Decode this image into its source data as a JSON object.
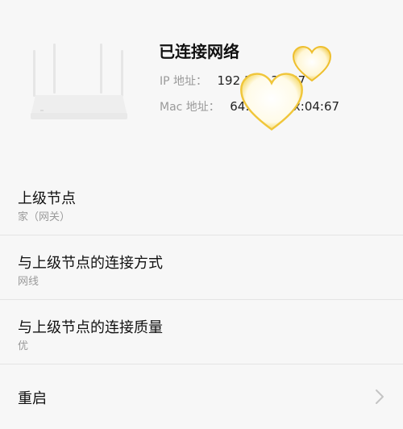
{
  "device": {
    "image": "router-image",
    "status": "已连接网络",
    "ip_label": "IP 地址：",
    "ip_value": "192.168.31.67",
    "mac_label": "Mac 地址：",
    "mac_value": "64:xx:xx:xx:04:67"
  },
  "items": [
    {
      "title": "上级节点",
      "subtitle": "家（网关）"
    },
    {
      "title": "与上级节点的连接方式",
      "subtitle": "网线"
    },
    {
      "title": "与上级节点的连接质量",
      "subtitle": "优"
    },
    {
      "title": "重启",
      "icon": "chevron-right-icon"
    }
  ],
  "stickers": [
    "heart-sticker-large",
    "heart-sticker-small"
  ]
}
